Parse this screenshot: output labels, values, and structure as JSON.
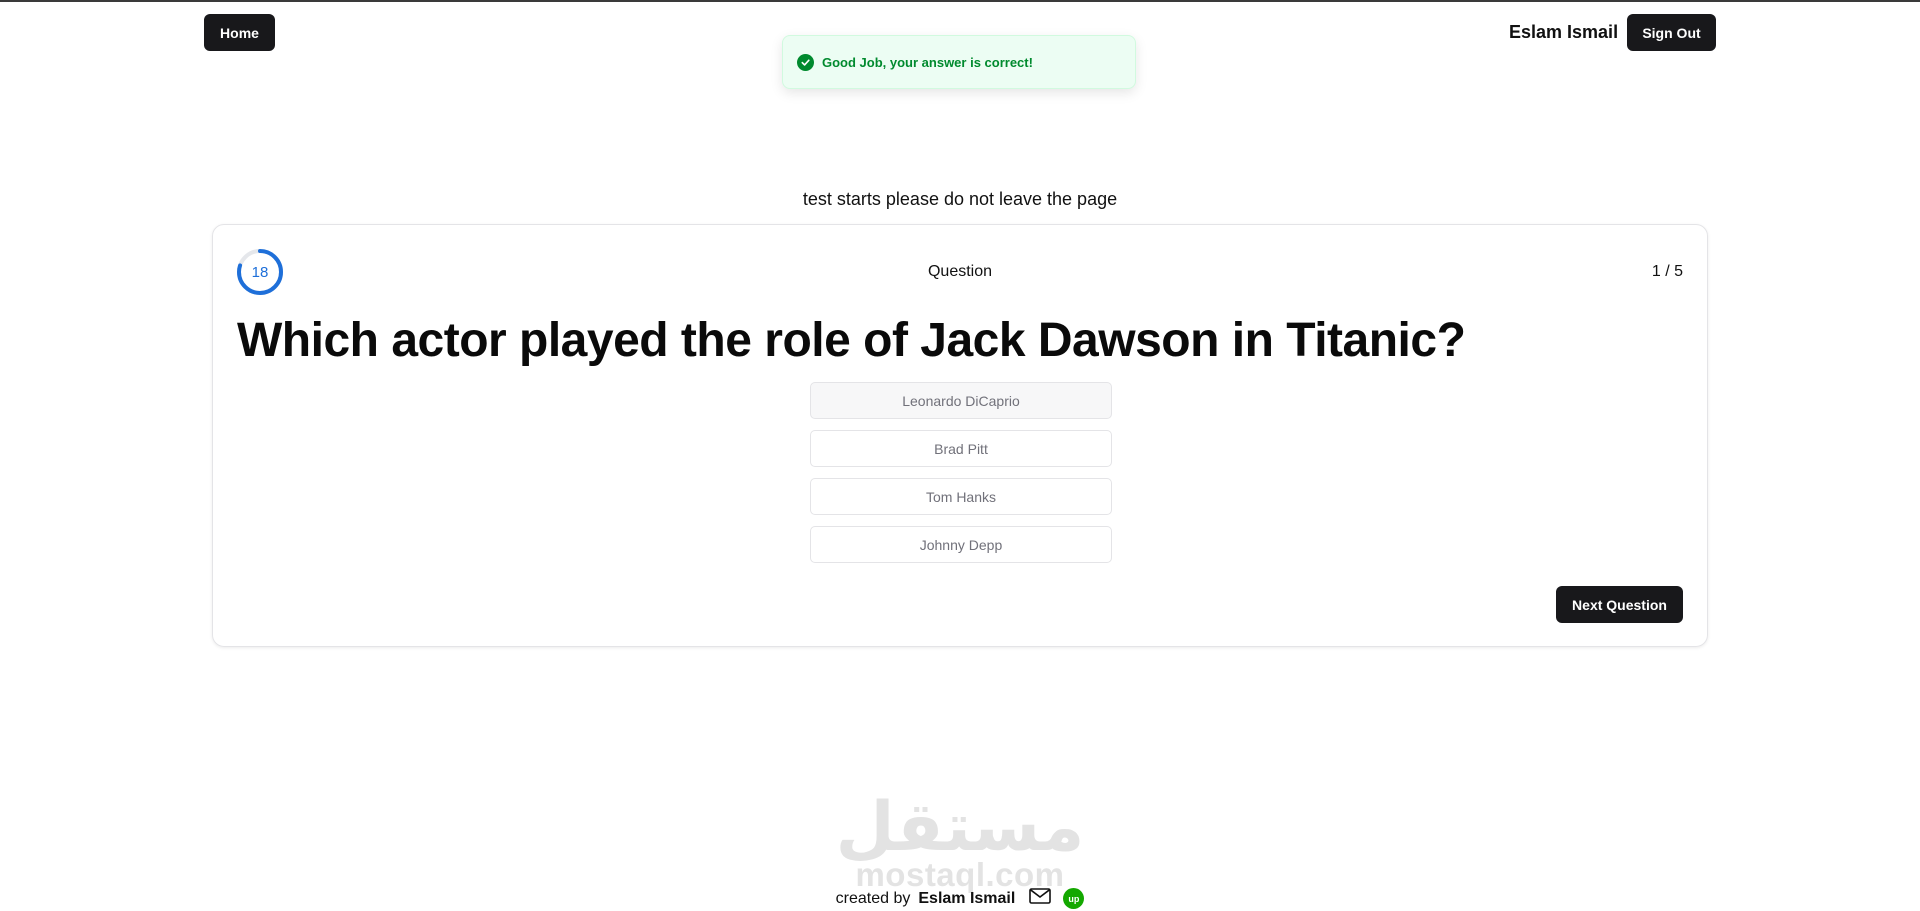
{
  "header": {
    "home_label": "Home",
    "user_name": "Eslam Ismail",
    "signout_label": "Sign Out"
  },
  "toast": {
    "message": "Good Job, your answer is correct!",
    "icon": "check-circle-icon",
    "color": "#008a2e"
  },
  "notice": "test starts please do not leave the page",
  "quiz": {
    "timer": "18",
    "timer_progress": 0.8,
    "label": "Question",
    "counter": "1 / 5",
    "question": "Which actor played the role of Jack Dawson in Titanic?",
    "options": [
      "Leonardo DiCaprio",
      "Brad Pitt",
      "Tom Hanks",
      "Johnny Depp"
    ],
    "selected_option": 0,
    "next_label": "Next Question"
  },
  "watermark": {
    "arabic": "مستقل",
    "url": "mostaql.com"
  },
  "footer": {
    "prefix": "created by",
    "author": "Eslam Ismail",
    "icons": [
      "mail-icon",
      "upwork-icon"
    ],
    "upwork_text": "up"
  },
  "colors": {
    "accent": "#1e6fd9",
    "dark_button": "#18181b",
    "success": "#008a2e",
    "upwork": "#14a800"
  }
}
